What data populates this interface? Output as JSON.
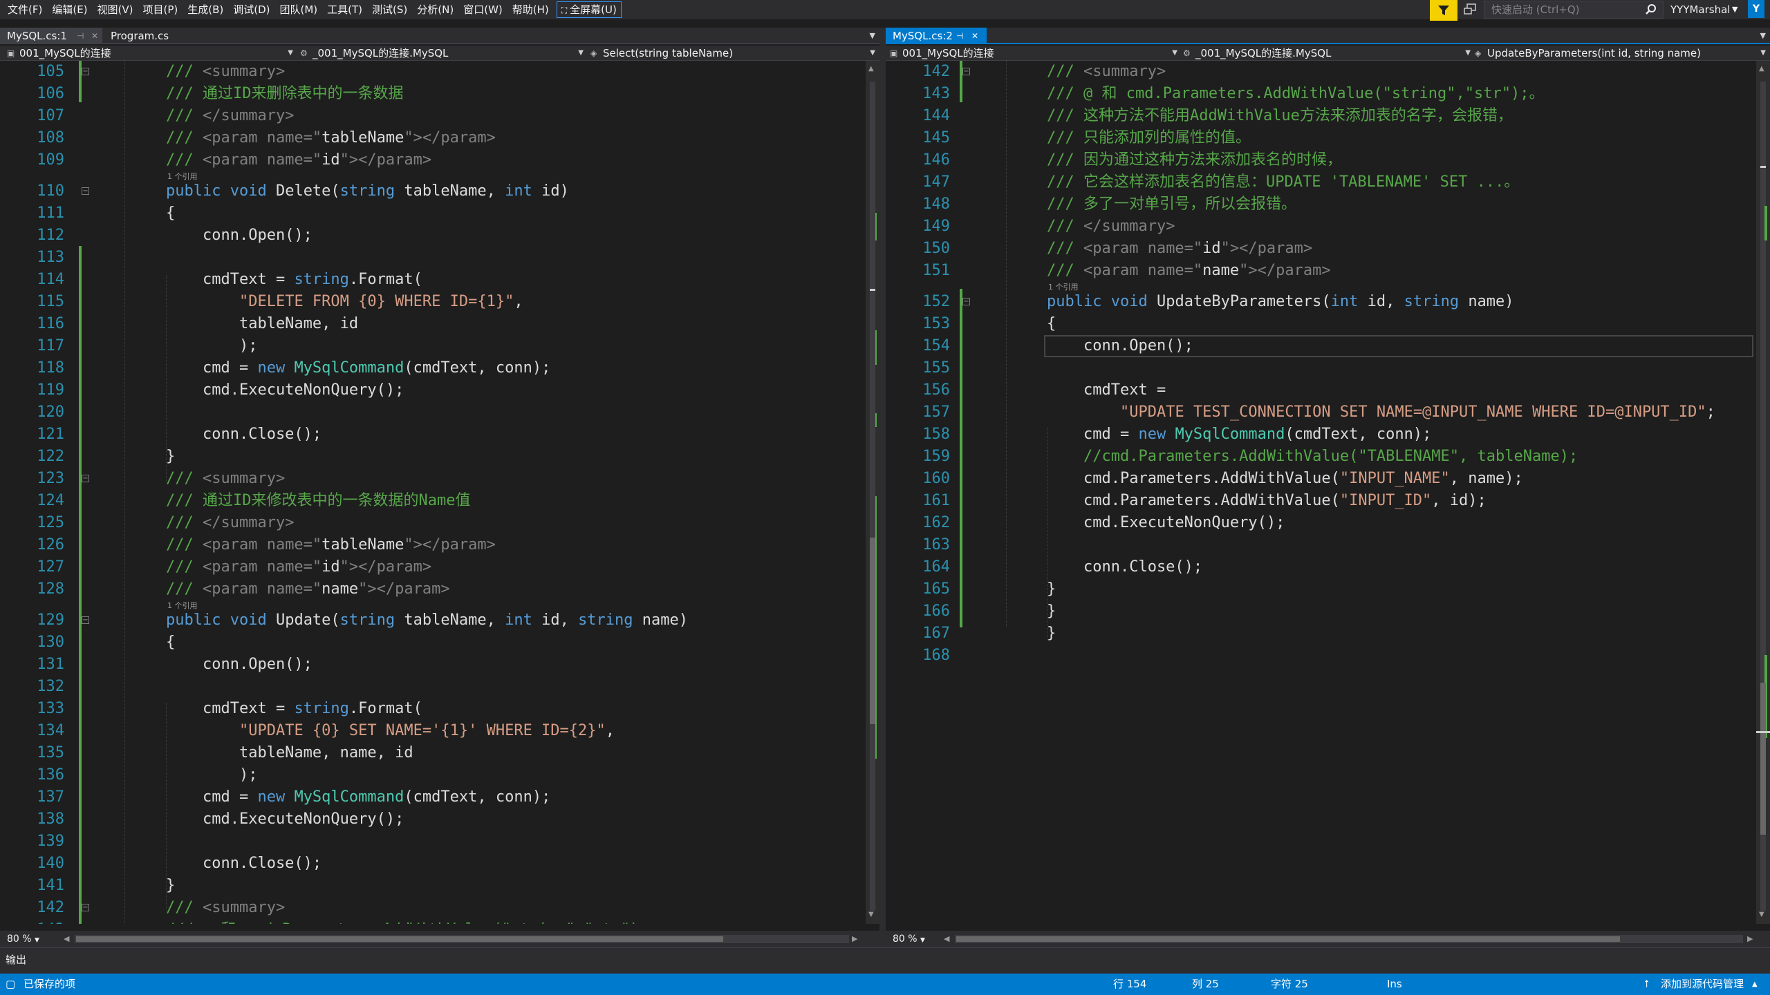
{
  "menu": [
    "文件(F)",
    "编辑(E)",
    "视图(V)",
    "项目(P)",
    "生成(B)",
    "调试(D)",
    "团队(M)",
    "工具(T)",
    "测试(S)",
    "分析(N)",
    "窗口(W)",
    "帮助(H)"
  ],
  "fullscreen_label": "全屏幕(U)",
  "quick_launch_placeholder": "快速启动 (Ctrl+Q)",
  "user_name": "YYYMarshal",
  "user_initial": "Y",
  "left_pane": {
    "tabs": [
      {
        "label": "MySQL.cs:1",
        "selected": true
      },
      {
        "label": "Program.cs",
        "selected": false
      }
    ],
    "nav": {
      "project": "001_MySQL的连接",
      "type": "_001_MySQL的连接.MySQL",
      "member": "Select(string tableName)"
    },
    "zoom": "80 %",
    "first_line": 105,
    "code": [
      {
        "n": 105,
        "t": [
          [
            "c",
            "/// "
          ],
          [
            "x",
            "<summary>"
          ]
        ]
      },
      {
        "n": 106,
        "t": [
          [
            "c",
            "/// 通过ID来删除表中的一条数据"
          ]
        ]
      },
      {
        "n": 107,
        "t": [
          [
            "c",
            "/// "
          ],
          [
            "x",
            "</summary>"
          ]
        ]
      },
      {
        "n": 108,
        "t": [
          [
            "c",
            "/// "
          ],
          [
            "x",
            "<param name=\""
          ],
          [
            "p",
            "tableName"
          ],
          [
            "x",
            "\"></param>"
          ]
        ]
      },
      {
        "n": 109,
        "t": [
          [
            "c",
            "/// "
          ],
          [
            "x",
            "<param name=\""
          ],
          [
            "p",
            "id"
          ],
          [
            "x",
            "\"></param>"
          ]
        ],
        "ref": "1 个引用"
      },
      {
        "n": 110,
        "t": [
          [
            "k",
            "public void "
          ],
          [
            "p",
            "Delete("
          ],
          [
            "k",
            "string "
          ],
          [
            "p",
            "tableName, "
          ],
          [
            "k",
            "int "
          ],
          [
            "p",
            "id)"
          ]
        ]
      },
      {
        "n": 111,
        "t": [
          [
            "p",
            "{"
          ]
        ]
      },
      {
        "n": 112,
        "t": [
          [
            "p",
            "    conn.Open();"
          ]
        ]
      },
      {
        "n": 113,
        "t": []
      },
      {
        "n": 114,
        "t": [
          [
            "p",
            "    cmdText = "
          ],
          [
            "k",
            "string"
          ],
          [
            "p",
            ".Format("
          ]
        ]
      },
      {
        "n": 115,
        "t": [
          [
            "p",
            "        "
          ],
          [
            "s",
            "\"DELETE FROM {0} WHERE ID={1}\""
          ],
          [
            "p",
            ","
          ]
        ]
      },
      {
        "n": 116,
        "t": [
          [
            "p",
            "        tableName, id"
          ]
        ]
      },
      {
        "n": 117,
        "t": [
          [
            "p",
            "        );"
          ]
        ]
      },
      {
        "n": 118,
        "t": [
          [
            "p",
            "    cmd = "
          ],
          [
            "k",
            "new "
          ],
          [
            "y",
            "MySqlCommand"
          ],
          [
            "p",
            "(cmdText, conn);"
          ]
        ]
      },
      {
        "n": 119,
        "t": [
          [
            "p",
            "    cmd.ExecuteNonQuery();"
          ]
        ]
      },
      {
        "n": 120,
        "t": []
      },
      {
        "n": 121,
        "t": [
          [
            "p",
            "    conn.Close();"
          ]
        ]
      },
      {
        "n": 122,
        "t": [
          [
            "p",
            "}"
          ]
        ]
      },
      {
        "n": 123,
        "t": [
          [
            "c",
            "/// "
          ],
          [
            "x",
            "<summary>"
          ]
        ]
      },
      {
        "n": 124,
        "t": [
          [
            "c",
            "/// 通过ID来修改表中的一条数据的Name值"
          ]
        ]
      },
      {
        "n": 125,
        "t": [
          [
            "c",
            "/// "
          ],
          [
            "x",
            "</summary>"
          ]
        ]
      },
      {
        "n": 126,
        "t": [
          [
            "c",
            "/// "
          ],
          [
            "x",
            "<param name=\""
          ],
          [
            "p",
            "tableName"
          ],
          [
            "x",
            "\"></param>"
          ]
        ]
      },
      {
        "n": 127,
        "t": [
          [
            "c",
            "/// "
          ],
          [
            "x",
            "<param name=\""
          ],
          [
            "p",
            "id"
          ],
          [
            "x",
            "\"></param>"
          ]
        ]
      },
      {
        "n": 128,
        "t": [
          [
            "c",
            "/// "
          ],
          [
            "x",
            "<param name=\""
          ],
          [
            "p",
            "name"
          ],
          [
            "x",
            "\"></param>"
          ]
        ],
        "ref": "1 个引用"
      },
      {
        "n": 129,
        "t": [
          [
            "k",
            "public void "
          ],
          [
            "p",
            "Update("
          ],
          [
            "k",
            "string "
          ],
          [
            "p",
            "tableName, "
          ],
          [
            "k",
            "int "
          ],
          [
            "p",
            "id, "
          ],
          [
            "k",
            "string "
          ],
          [
            "p",
            "name)"
          ]
        ]
      },
      {
        "n": 130,
        "t": [
          [
            "p",
            "{"
          ]
        ]
      },
      {
        "n": 131,
        "t": [
          [
            "p",
            "    conn.Open();"
          ]
        ]
      },
      {
        "n": 132,
        "t": []
      },
      {
        "n": 133,
        "t": [
          [
            "p",
            "    cmdText = "
          ],
          [
            "k",
            "string"
          ],
          [
            "p",
            ".Format("
          ]
        ]
      },
      {
        "n": 134,
        "t": [
          [
            "p",
            "        "
          ],
          [
            "s",
            "\"UPDATE {0} SET NAME='{1}' WHERE ID={2}\""
          ],
          [
            "p",
            ","
          ]
        ]
      },
      {
        "n": 135,
        "t": [
          [
            "p",
            "        tableName, name, id"
          ]
        ]
      },
      {
        "n": 136,
        "t": [
          [
            "p",
            "        );"
          ]
        ]
      },
      {
        "n": 137,
        "t": [
          [
            "p",
            "    cmd = "
          ],
          [
            "k",
            "new "
          ],
          [
            "y",
            "MySqlCommand"
          ],
          [
            "p",
            "(cmdText, conn);"
          ]
        ]
      },
      {
        "n": 138,
        "t": [
          [
            "p",
            "    cmd.ExecuteNonQuery();"
          ]
        ]
      },
      {
        "n": 139,
        "t": []
      },
      {
        "n": 140,
        "t": [
          [
            "p",
            "    conn.Close();"
          ]
        ]
      },
      {
        "n": 141,
        "t": [
          [
            "p",
            "}"
          ]
        ]
      },
      {
        "n": 142,
        "t": [
          [
            "c",
            "/// "
          ],
          [
            "x",
            "<summary>"
          ]
        ]
      },
      {
        "n": 143,
        "t": [
          [
            "c",
            "/// @ 和 cmd.Parameters.AddWithValue(\"string\",\"str\");。"
          ]
        ]
      }
    ]
  },
  "right_pane": {
    "tabs": [
      {
        "label": "MySQL.cs:2",
        "selected": true
      }
    ],
    "nav": {
      "project": "001_MySQL的连接",
      "type": "_001_MySQL的连接.MySQL",
      "member": "UpdateByParameters(int id, string name)"
    },
    "zoom": "80 %",
    "first_line": 142,
    "current_line": 154,
    "code": [
      {
        "n": 142,
        "t": [
          [
            "c",
            "/// "
          ],
          [
            "x",
            "<summary>"
          ]
        ]
      },
      {
        "n": 143,
        "t": [
          [
            "c",
            "/// @ 和 cmd.Parameters.AddWithValue(\"string\",\"str\");。"
          ]
        ]
      },
      {
        "n": 144,
        "t": [
          [
            "c",
            "/// 这种方法不能用AddWithValue方法来添加表的名字，会报错，"
          ]
        ]
      },
      {
        "n": 145,
        "t": [
          [
            "c",
            "/// 只能添加列的属性的值。"
          ]
        ]
      },
      {
        "n": 146,
        "t": [
          [
            "c",
            "/// 因为通过这种方法来添加表名的时候，"
          ]
        ]
      },
      {
        "n": 147,
        "t": [
          [
            "c",
            "/// 它会这样添加表名的信息：UPDATE 'TABLENAME' SET ...。"
          ]
        ]
      },
      {
        "n": 148,
        "t": [
          [
            "c",
            "/// 多了一对单引号，所以会报错。"
          ]
        ]
      },
      {
        "n": 149,
        "t": [
          [
            "c",
            "/// "
          ],
          [
            "x",
            "</summary>"
          ]
        ]
      },
      {
        "n": 150,
        "t": [
          [
            "c",
            "/// "
          ],
          [
            "x",
            "<param name=\""
          ],
          [
            "p",
            "id"
          ],
          [
            "x",
            "\"></param>"
          ]
        ]
      },
      {
        "n": 151,
        "t": [
          [
            "c",
            "/// "
          ],
          [
            "x",
            "<param name=\""
          ],
          [
            "p",
            "name"
          ],
          [
            "x",
            "\"></param>"
          ]
        ],
        "ref": "1 个引用"
      },
      {
        "n": 152,
        "t": [
          [
            "k",
            "public void "
          ],
          [
            "p",
            "UpdateByParameters("
          ],
          [
            "k",
            "int "
          ],
          [
            "p",
            "id, "
          ],
          [
            "k",
            "string "
          ],
          [
            "p",
            "name)"
          ]
        ]
      },
      {
        "n": 153,
        "t": [
          [
            "p",
            "{"
          ]
        ]
      },
      {
        "n": 154,
        "t": [
          [
            "p",
            "    conn.Open();"
          ]
        ]
      },
      {
        "n": 155,
        "t": []
      },
      {
        "n": 156,
        "t": [
          [
            "p",
            "    cmdText ="
          ]
        ]
      },
      {
        "n": 157,
        "t": [
          [
            "p",
            "        "
          ],
          [
            "s",
            "\"UPDATE TEST_CONNECTION SET NAME=@INPUT_NAME WHERE ID=@INPUT_ID\""
          ],
          [
            "p",
            ";"
          ]
        ]
      },
      {
        "n": 158,
        "t": [
          [
            "p",
            "    cmd = "
          ],
          [
            "k",
            "new "
          ],
          [
            "y",
            "MySqlCommand"
          ],
          [
            "p",
            "(cmdText, conn);"
          ]
        ]
      },
      {
        "n": 159,
        "t": [
          [
            "c",
            "    //cmd.Parameters.AddWithValue(\"TABLENAME\", tableName);"
          ]
        ]
      },
      {
        "n": 160,
        "t": [
          [
            "p",
            "    cmd.Parameters.AddWithValue("
          ],
          [
            "s",
            "\"INPUT_NAME\""
          ],
          [
            "p",
            ", name);"
          ]
        ]
      },
      {
        "n": 161,
        "t": [
          [
            "p",
            "    cmd.Parameters.AddWithValue("
          ],
          [
            "s",
            "\"INPUT_ID\""
          ],
          [
            "p",
            ", id);"
          ]
        ]
      },
      {
        "n": 162,
        "t": [
          [
            "p",
            "    cmd.ExecuteNonQuery();"
          ]
        ]
      },
      {
        "n": 163,
        "t": []
      },
      {
        "n": 164,
        "t": [
          [
            "p",
            "    conn.Close();"
          ]
        ]
      },
      {
        "n": 165,
        "t": [
          [
            "p",
            "}"
          ]
        ]
      },
      {
        "n": 166,
        "t": [
          [
            "p",
            "}"
          ]
        ]
      },
      {
        "n": 167,
        "t": [
          [
            "p",
            "}"
          ]
        ]
      },
      {
        "n": 168,
        "t": []
      }
    ]
  },
  "output_label": "输出",
  "status": {
    "saved": "已保存的项",
    "line": "行 154",
    "col": "列 25",
    "ch": "字符 25",
    "mode": "Ins",
    "source_control": "添加到源代码管理"
  },
  "colors": {
    "accent": "#007acc",
    "comment": "#57a64a",
    "xml_doc_tag": "#808080",
    "keyword": "#569cd6",
    "type": "#4ec9b0",
    "string": "#d69d85",
    "line_number": "#2b91af"
  },
  "icons": [
    "filter-icon",
    "feedback-icon",
    "search-icon",
    "pin-icon",
    "close-icon",
    "fold-icon",
    "scroll-arrow-icon",
    "upload-icon",
    "fullscreen-icon"
  ]
}
